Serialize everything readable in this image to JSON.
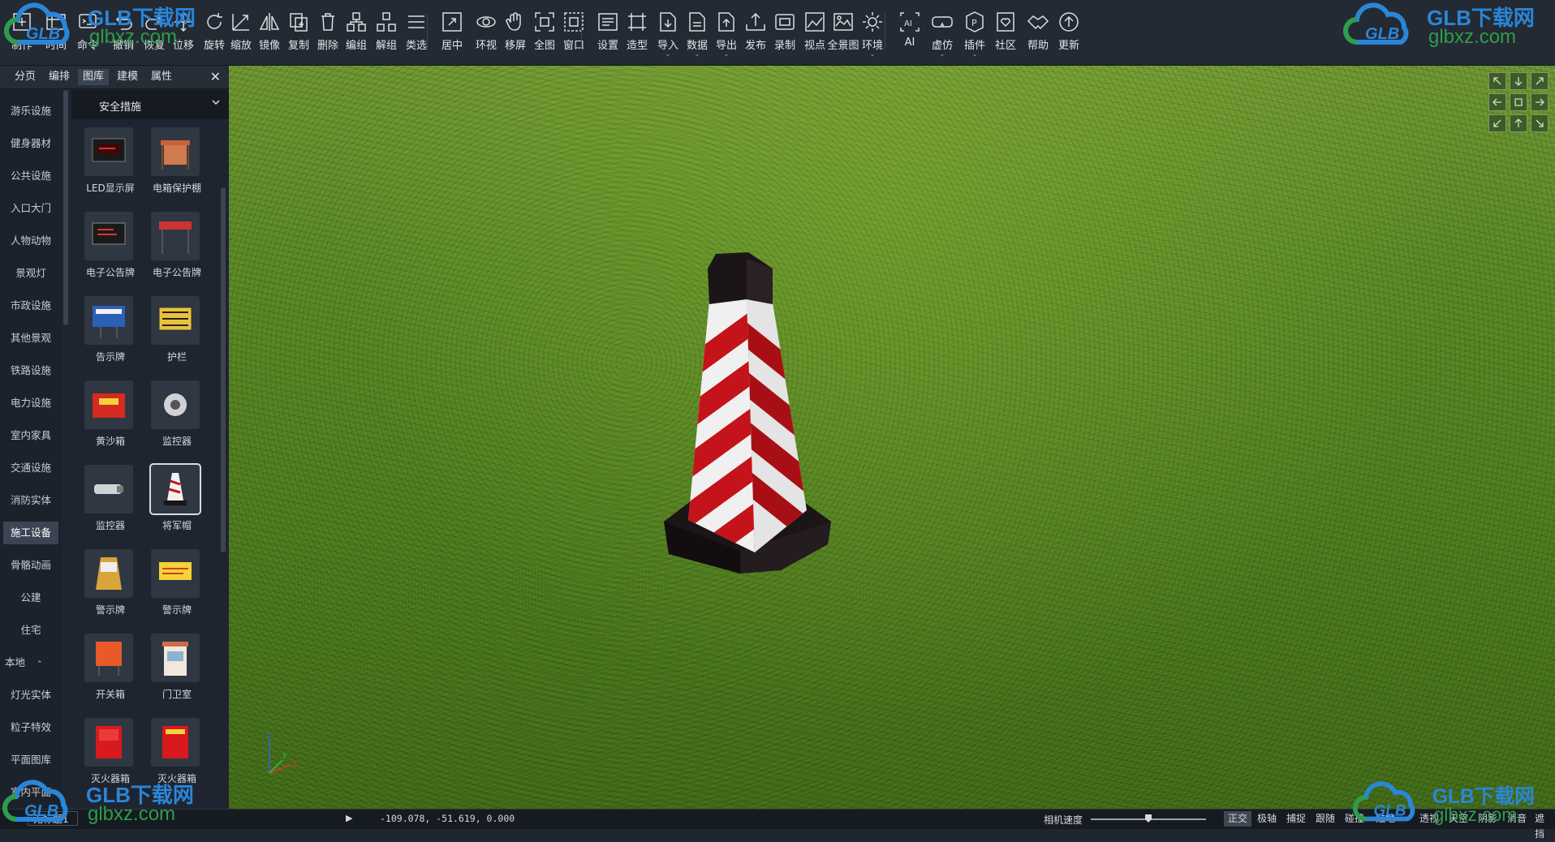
{
  "toolbar": {
    "tools": [
      {
        "label": "制作",
        "icon": "make-icon"
      },
      {
        "label": "时间",
        "icon": "timeline-icon"
      },
      {
        "label": "命令",
        "icon": "command-icon"
      },
      {
        "label": "撤销",
        "icon": "undo-icon"
      },
      {
        "label": "恢复",
        "icon": "redo-icon"
      },
      {
        "label": "位移",
        "icon": "move-icon"
      },
      {
        "label": "旋转",
        "icon": "rotate-icon"
      },
      {
        "label": "缩放",
        "icon": "scale-icon"
      },
      {
        "label": "镜像",
        "icon": "mirror-icon"
      },
      {
        "label": "复制",
        "icon": "copy-icon"
      },
      {
        "label": "删除",
        "icon": "delete-icon"
      },
      {
        "label": "编组",
        "icon": "group-icon"
      },
      {
        "label": "解组",
        "icon": "ungroup-icon"
      },
      {
        "label": "类选",
        "icon": "select-by-type-icon"
      },
      {
        "label": "居中",
        "icon": "center-icon"
      },
      {
        "label": "环视",
        "icon": "orbit-icon"
      },
      {
        "label": "移屏",
        "icon": "pan-hand-icon"
      },
      {
        "label": "全图",
        "icon": "zoom-extents-icon"
      },
      {
        "label": "窗口",
        "icon": "zoom-window-icon"
      },
      {
        "label": "设置",
        "icon": "settings-icon"
      },
      {
        "label": "造型",
        "icon": "modeling-icon"
      },
      {
        "label": "导入",
        "icon": "import-icon",
        "dropdown": true
      },
      {
        "label": "数据",
        "icon": "data-icon",
        "dropdown": true
      },
      {
        "label": "导出",
        "icon": "export-icon",
        "dropdown": true
      },
      {
        "label": "发布",
        "icon": "publish-icon"
      },
      {
        "label": "录制",
        "icon": "record-icon"
      },
      {
        "label": "视点",
        "icon": "viewpoint-icon"
      },
      {
        "label": "全景图",
        "icon": "panorama-icon"
      },
      {
        "label": "环境",
        "icon": "environment-sun-icon",
        "dropdown": true
      },
      {
        "label": "AI",
        "icon": "ai-icon"
      },
      {
        "label": "虚仿",
        "icon": "vr-icon",
        "dropdown": true
      },
      {
        "label": "插件",
        "icon": "plugin-icon",
        "dropdown": true
      },
      {
        "label": "社区",
        "icon": "community-icon"
      },
      {
        "label": "帮助",
        "icon": "help-handshake-icon"
      },
      {
        "label": "更新",
        "icon": "update-icon"
      }
    ]
  },
  "watermark": {
    "brand": "GLB下载网",
    "domain": "glbxz.com",
    "logo": "GLB"
  },
  "panel": {
    "tabs": [
      "分页",
      "编排",
      "图库",
      "建模",
      "属性"
    ],
    "active_tab": "图库",
    "close": "✕",
    "categories": [
      "游乐设施",
      "健身器材",
      "公共设施",
      "入口大门",
      "人物动物",
      "景观灯",
      "市政设施",
      "其他景观",
      "铁路设施",
      "电力设施",
      "室内家具",
      "交通设施",
      "消防实体",
      "施工设备",
      "骨骼动画",
      "公建",
      "住宅",
      "本地",
      "灯光实体",
      "粒子特效",
      "平面图库",
      "室内平面"
    ],
    "active_category": "施工设备",
    "library_select": "安全措施",
    "items": [
      {
        "name": "LED显示屏",
        "thumb": "led-screen"
      },
      {
        "name": "电箱保护棚",
        "thumb": "box-shelter"
      },
      {
        "name": "电子公告牌",
        "thumb": "e-board"
      },
      {
        "name": "电子公告牌",
        "thumb": "e-board-frame"
      },
      {
        "name": "告示牌",
        "thumb": "notice-sign"
      },
      {
        "name": "护栏",
        "thumb": "guardrail"
      },
      {
        "name": "黄沙箱",
        "thumb": "sand-box"
      },
      {
        "name": "监控器",
        "thumb": "monitor-dome"
      },
      {
        "name": "监控器",
        "thumb": "monitor-bullet"
      },
      {
        "name": "将军帽",
        "thumb": "traffic-cone"
      },
      {
        "name": "警示牌",
        "thumb": "warning-board"
      },
      {
        "name": "警示牌",
        "thumb": "warning-sign-yellow"
      },
      {
        "name": "开关箱",
        "thumb": "switch-box"
      },
      {
        "name": "门卫室",
        "thumb": "guard-house"
      },
      {
        "name": "灭火器箱",
        "thumb": "extinguisher-box"
      },
      {
        "name": "灭火器箱",
        "thumb": "extinguisher-box-2"
      }
    ],
    "selected_item": 9
  },
  "viewport": {
    "axis_labels": [
      "Z",
      "Y",
      "X"
    ]
  },
  "status": {
    "file_name": "无标题1",
    "coords": "-109.078, -51.619, 0.000",
    "camera_speed_label": "相机速度",
    "camera_speed": 0.5,
    "buttons": [
      {
        "label": "正交",
        "on": true
      },
      {
        "label": "极轴",
        "on": false
      },
      {
        "label": "捕捉",
        "on": false
      },
      {
        "label": "跟随",
        "on": false
      },
      {
        "label": "碰撞",
        "on": false
      },
      {
        "label": "贴地",
        "on": false
      },
      {
        "label": "透视",
        "on": false
      },
      {
        "label": "天空",
        "on": false
      },
      {
        "label": "阴影",
        "on": false
      },
      {
        "label": "消音",
        "on": false
      },
      {
        "label": "遮挡",
        "on": false
      }
    ]
  },
  "colors": {
    "bg": "#20262f",
    "grass": "#4f7e1e",
    "cone_red": "#c4131a",
    "cone_white": "#f2f2f2",
    "cone_base": "#1a1416"
  }
}
